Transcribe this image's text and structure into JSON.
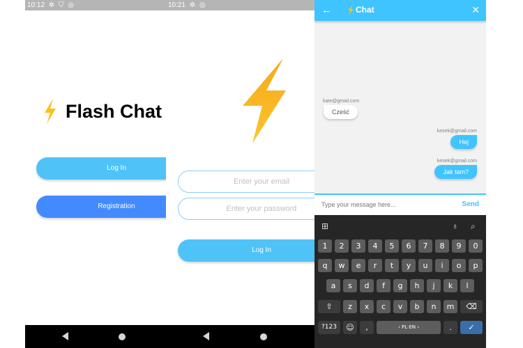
{
  "screen1": {
    "status_time": "10:12",
    "app_title": "Flash Chat",
    "login_label": "Log In",
    "register_label": "Registration"
  },
  "screen2": {
    "status_time": "10:21",
    "email_placeholder": "Enter your email",
    "password_placeholder": "Enter your password",
    "login_label": "Log In"
  },
  "screen3": {
    "title": "Chat",
    "messages": [
      {
        "sender": "kate@gmail.com",
        "text": "Cześć",
        "is_me": false
      },
      {
        "sender": "kesek@gmail.com",
        "text": "Hej",
        "is_me": true
      },
      {
        "sender": "kesek@gmail.com",
        "text": "Jak tam?",
        "is_me": true
      }
    ],
    "input_placeholder": "Type your message here...",
    "send_label": "Send",
    "keyboard": {
      "row1": [
        "1",
        "2",
        "3",
        "4",
        "5",
        "6",
        "7",
        "8",
        "9",
        "0"
      ],
      "row2": [
        "q",
        "w",
        "e",
        "r",
        "t",
        "y",
        "u",
        "i",
        "o",
        "p"
      ],
      "row3": [
        "a",
        "s",
        "d",
        "f",
        "g",
        "h",
        "j",
        "k",
        "l"
      ],
      "row4": [
        "z",
        "x",
        "c",
        "v",
        "b",
        "n",
        "m"
      ],
      "symbols_label": "?123",
      "comma": ",",
      "space_label": "‹ PL·EN ›",
      "period": "."
    }
  },
  "colors": {
    "accent_light": "#4fc3f7",
    "accent_blue": "#448aff",
    "appbar": "#40c4ff",
    "bolt_yellow": "#f9c21a"
  }
}
